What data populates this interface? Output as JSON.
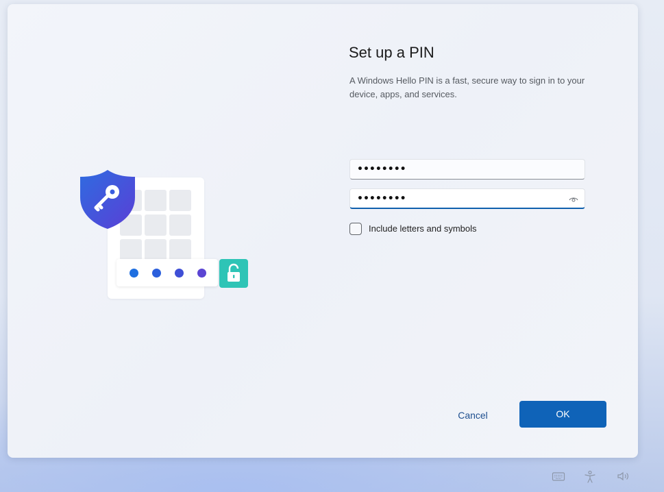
{
  "dialog": {
    "title": "Set up a PIN",
    "description": "A Windows Hello PIN is a fast, secure way to sign in to your device, apps, and services."
  },
  "form": {
    "pin_value": "••••••••",
    "confirm_pin_value": "••••••••",
    "include_letters_label": "Include letters and symbols",
    "include_letters_checked": false
  },
  "buttons": {
    "cancel": "Cancel",
    "ok": "OK"
  },
  "illustration": {
    "dot_colors": [
      "#1f6fe0",
      "#2b5fdc",
      "#3f4fd6",
      "#5b45d3"
    ],
    "lock_color": "#2ec4b6",
    "shield_color": "#2a5bd7"
  },
  "tray_icons": [
    "keyboard-icon",
    "accessibility-icon",
    "volume-icon"
  ],
  "accent_color": "#0f63b8"
}
